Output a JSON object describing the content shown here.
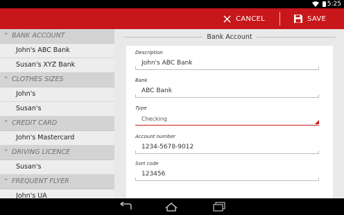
{
  "status_bar": {
    "time": "5:25"
  },
  "action_bar": {
    "cancel_label": "CANCEL",
    "save_label": "SAVE",
    "accent_color": "#c8171b"
  },
  "sidebar": {
    "groups": [
      {
        "header": "BANK ACCOUNT",
        "items": [
          "John's ABC Bank",
          "Susan's XYZ Bank"
        ]
      },
      {
        "header": "CLOTHES SIZES",
        "items": [
          "John's",
          "Susan's"
        ]
      },
      {
        "header": "CREDIT CARD",
        "items": [
          "John's Mastercard"
        ]
      },
      {
        "header": "DRIVING LICENCE",
        "items": [
          "Susan's"
        ]
      },
      {
        "header": "FREQUENT FLYER",
        "items": [
          "John's UA"
        ]
      }
    ]
  },
  "form": {
    "title": "Bank Account",
    "fields": [
      {
        "label": "Description",
        "value": "John's ABC Bank"
      },
      {
        "label": "Bank",
        "value": "ABC Bank"
      },
      {
        "label": "Type",
        "value": "Checking"
      },
      {
        "label": "Account number",
        "value": "1234-5678-9012"
      },
      {
        "label": "Sort code",
        "value": "123456"
      }
    ]
  },
  "icons": {
    "cancel": "close-icon",
    "save": "save-icon",
    "back": "back-icon",
    "home": "home-icon",
    "recents": "recent-apps-icon",
    "wifi": "wifi-icon",
    "battery": "battery-icon"
  }
}
